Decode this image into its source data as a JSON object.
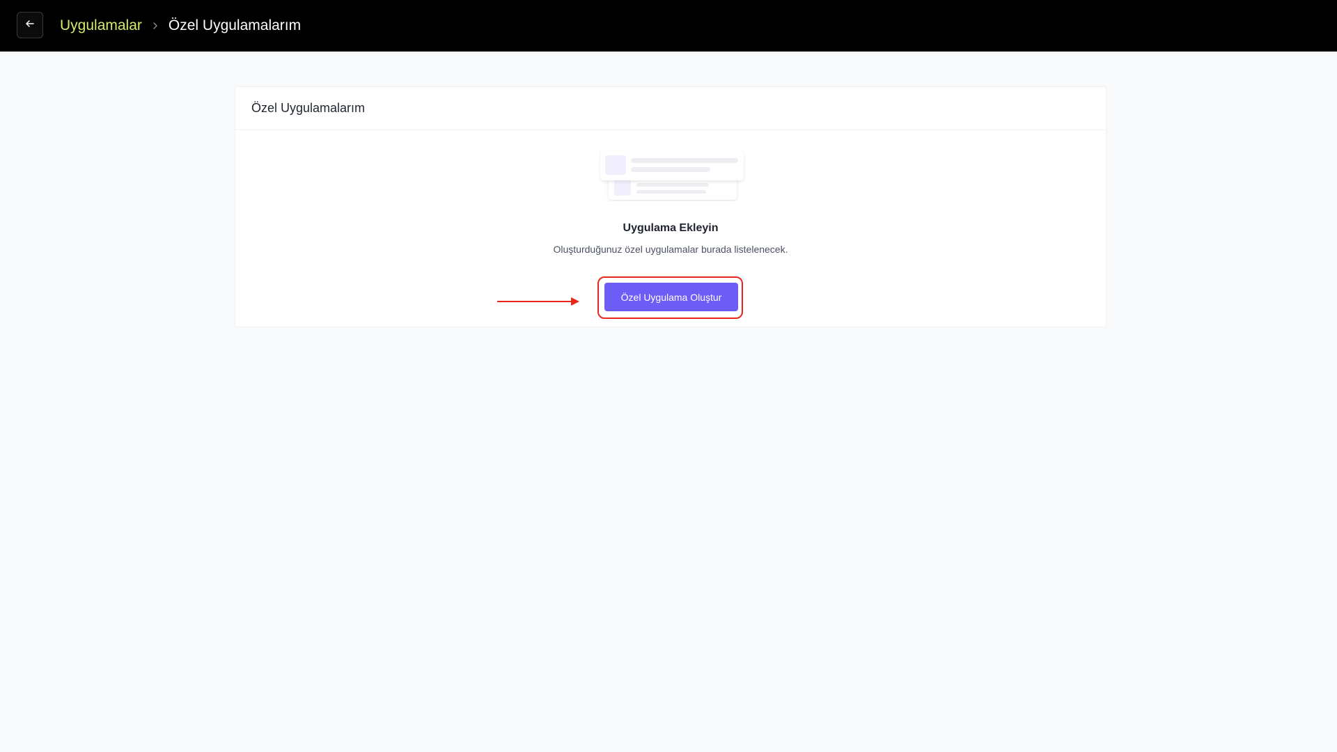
{
  "topbar": {
    "back_icon": "arrow-left-icon",
    "breadcrumb": {
      "parent": "Uygulamalar",
      "separator_icon": "chevron-right-icon",
      "current": "Özel Uygulamalarım"
    },
    "colors": {
      "background": "#000000",
      "link": "#d9e96b"
    }
  },
  "card": {
    "title": "Özel Uygulamalarım",
    "empty_state": {
      "illustration_icon": "list-placeholder-illustration",
      "title": "Uygulama Ekleyin",
      "description": "Oluşturduğunuz özel uygulamalar burada listelenecek.",
      "button_label": "Özel Uygulama Oluştur"
    }
  },
  "annotation": {
    "arrow_icon": "arrow-right-icon",
    "highlight_color": "#e8261b"
  },
  "colors": {
    "accent": "#6d5cf5",
    "page_background": "#f8f9fb"
  }
}
